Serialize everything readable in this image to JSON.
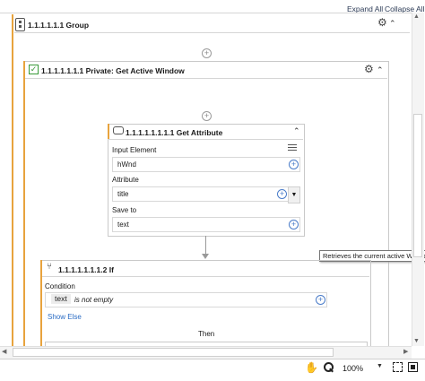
{
  "toolbar": {
    "expand_all": "Expand All",
    "collapse_all": "Collapse All"
  },
  "group": {
    "title": "1.1.1.1.1.1 Group"
  },
  "private": {
    "title": "1.1.1.1.1.1.1 Private: Get Active Window"
  },
  "get_attribute": {
    "title": "1.1.1.1.1.1.1.1 Get Attribute",
    "input_element_label": "Input Element",
    "input_element_value": "hWnd",
    "attribute_label": "Attribute",
    "attribute_value": "title",
    "save_to_label": "Save to",
    "save_to_value": "text"
  },
  "tooltip": {
    "text": "Retrieves the current active Windo"
  },
  "if_activity": {
    "title": "1.1.1.1.1.1.1.2 If",
    "condition_label": "Condition",
    "condition_variable": "text",
    "condition_operator": "is not empty",
    "show_else": "Show Else",
    "then_label": "Then"
  },
  "statusbar": {
    "zoom": "100%"
  },
  "colors": {
    "accent": "#e8a33d",
    "link_blue": "#2a6cc4",
    "border": "#c9c9c9"
  }
}
